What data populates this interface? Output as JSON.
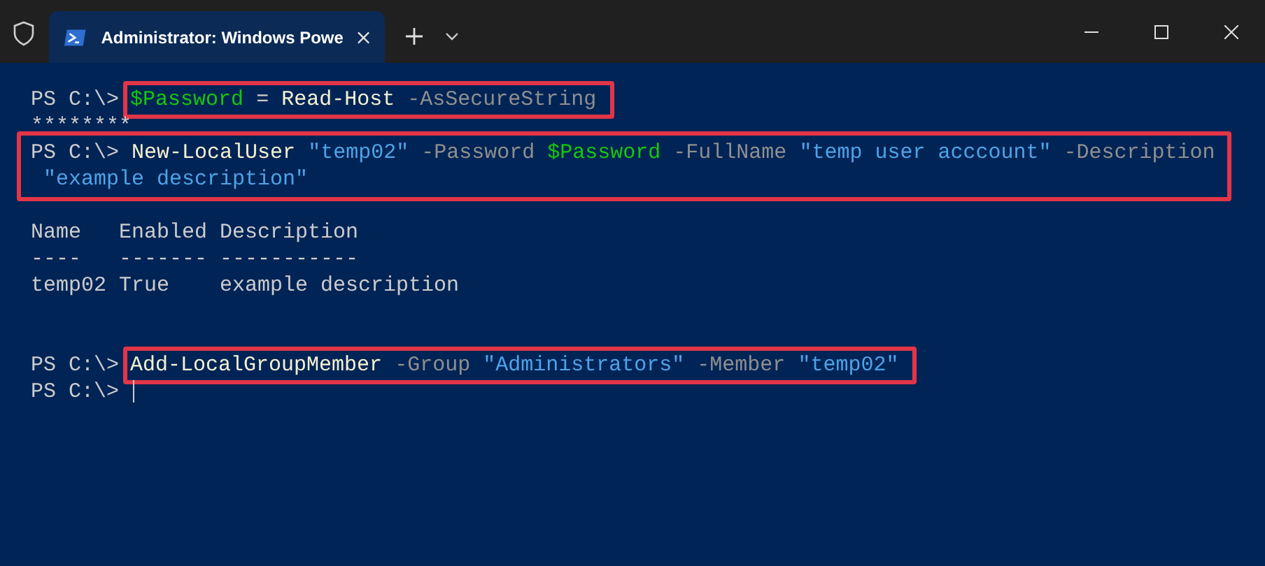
{
  "tab": {
    "title": "Administrator: Windows Powe",
    "selected": true
  },
  "lines": [
    {
      "kind": "marked_command",
      "prompt": "PS C:\\>",
      "cursor": false,
      "tokens": [
        {
          "text": "$Password",
          "kind": "variable"
        },
        {
          "text": "=",
          "kind": "operator"
        },
        {
          "text": "Read-Host",
          "kind": "cmdlet"
        },
        {
          "text": "-AsSecureString",
          "kind": "parameter"
        }
      ]
    },
    {
      "kind": "output",
      "text": "********"
    },
    {
      "kind": "marked_block",
      "prompt": "PS C:\\>",
      "cursor": false,
      "tokens": [
        {
          "text": "New-LocalUser",
          "kind": "cmdlet"
        },
        {
          "text": "\"temp02\"",
          "kind": "string"
        },
        {
          "text": "-Password",
          "kind": "parameter"
        },
        {
          "text": "$Password",
          "kind": "variable"
        },
        {
          "text": "-FullName",
          "kind": "parameter"
        },
        {
          "text": "\"temp user acccount\"",
          "kind": "string"
        },
        {
          "text": "-Description",
          "kind": "parameter"
        }
      ],
      "continuation": [
        {
          "text": "\"example description\"",
          "kind": "string"
        }
      ]
    },
    {
      "kind": "blank"
    },
    {
      "kind": "output",
      "text": "Name   Enabled Description"
    },
    {
      "kind": "output",
      "text": "----   ------- -----------"
    },
    {
      "kind": "output",
      "text": "temp02 True    example description"
    },
    {
      "kind": "blank"
    },
    {
      "kind": "blank"
    },
    {
      "kind": "marked_command",
      "prompt": "PS C:\\>",
      "cursor": false,
      "tokens": [
        {
          "text": "Add-LocalGroupMember",
          "kind": "cmdlet"
        },
        {
          "text": "-Group",
          "kind": "parameter"
        },
        {
          "text": "\"Administrators\"",
          "kind": "string"
        },
        {
          "text": "-Member",
          "kind": "parameter"
        },
        {
          "text": "\"temp02\"",
          "kind": "string"
        }
      ]
    },
    {
      "kind": "command",
      "prompt": "PS C:\\>",
      "cursor": true
    }
  ]
}
